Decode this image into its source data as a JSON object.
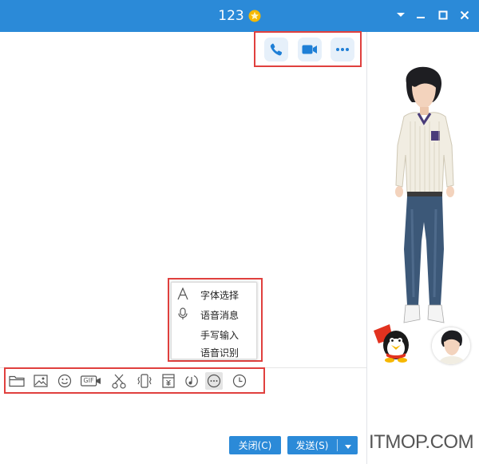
{
  "window": {
    "title": "123",
    "title_badge_icon": "star-badge-icon",
    "controls": [
      "dropdown-icon",
      "minimize-icon",
      "maximize-icon",
      "close-icon"
    ],
    "titlebar_color": "#2b8ad8"
  },
  "call_toolbar": {
    "buttons": [
      {
        "icon": "phone-icon"
      },
      {
        "icon": "video-camera-icon"
      },
      {
        "icon": "more-icon"
      }
    ]
  },
  "popup_menu": {
    "items": [
      {
        "icon": "font-icon",
        "label": "字体选择"
      },
      {
        "icon": "microphone-icon",
        "label": "语音消息"
      },
      {
        "icon": "",
        "label": "手写输入"
      },
      {
        "icon": "",
        "label": "语音识别"
      }
    ]
  },
  "input_toolbar": {
    "tools": [
      {
        "icon": "folder-icon"
      },
      {
        "icon": "image-icon"
      },
      {
        "icon": "emoji-icon"
      },
      {
        "icon": "gif-icon",
        "label": "GIF"
      },
      {
        "icon": "scissors-icon"
      },
      {
        "icon": "shake-icon"
      },
      {
        "icon": "red-packet-icon"
      },
      {
        "icon": "music-icon"
      },
      {
        "icon": "more-circle-icon"
      },
      {
        "icon": "clock-icon"
      }
    ]
  },
  "footer": {
    "close_label": "关闭(C)",
    "send_label": "发送(S)",
    "send_menu_icon": "caret-down-icon",
    "button_color": "#2b8ad8"
  },
  "side_panel": {
    "watermark": "ITMOP.COM"
  },
  "highlight_color": "#e0403e"
}
